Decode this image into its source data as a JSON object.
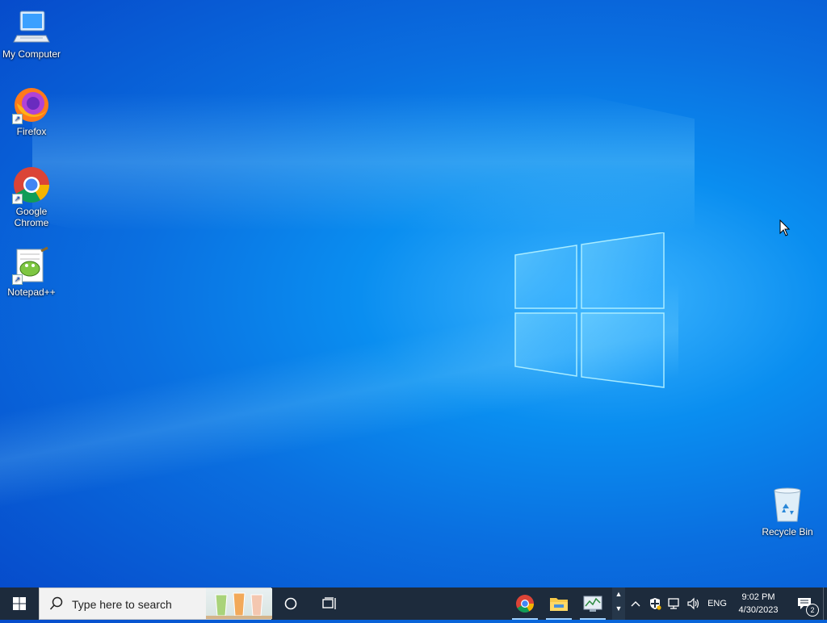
{
  "desktop": {
    "icons": [
      {
        "label": "My Computer",
        "icon": "computer-icon"
      },
      {
        "label": "Firefox",
        "icon": "firefox-icon"
      },
      {
        "label": "Google Chrome",
        "icon": "chrome-icon"
      },
      {
        "label": "Notepad++",
        "icon": "notepadpp-icon"
      },
      {
        "label": "Recycle Bin",
        "icon": "recycle-bin-icon"
      }
    ]
  },
  "taskbar": {
    "search_placeholder": "Type here to search",
    "pinned": [
      "chrome-icon",
      "file-explorer-icon",
      "task-manager-icon"
    ],
    "tray": {
      "language": "ENG",
      "time": "9:02 PM",
      "date": "4/30/2023",
      "notification_count": "2"
    }
  },
  "colors": {
    "wallpaper": "#0a78e6",
    "taskbar": "#1d2b3c",
    "search_box": "#f2f2f2"
  }
}
